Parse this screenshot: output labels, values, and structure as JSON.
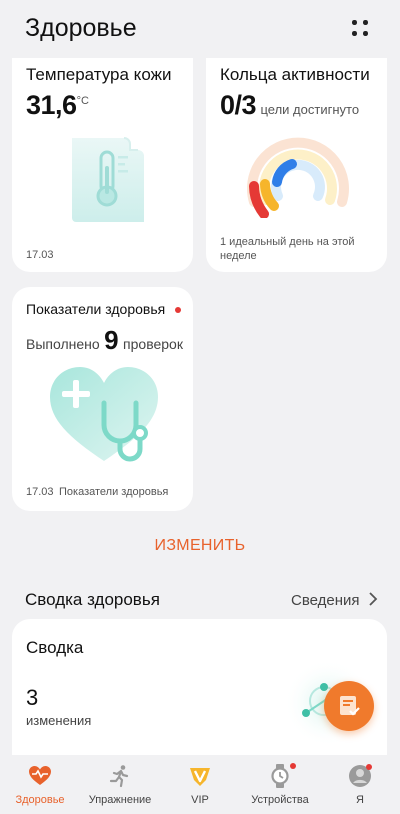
{
  "header": {
    "title": "Здоровье"
  },
  "skin_temp": {
    "title": "Температура кожи",
    "value": "31,6",
    "unit": "°C",
    "date": "17.03"
  },
  "activity": {
    "title": "Кольца активности",
    "value": "0/3",
    "suffix": "цели достигнуто",
    "note_line1": "1 идеальный день на этой",
    "note_line2": "неделе"
  },
  "health_indicators": {
    "title": "Показатели здоровья",
    "done_prefix": "Выполнено",
    "done_count": "9",
    "done_suffix": "проверок",
    "date": "17.03",
    "footer_label": "Показатели здоровья"
  },
  "edit_label": "ИЗМЕНИТЬ",
  "summary_section": {
    "title": "Сводка здоровья",
    "link": "Сведения"
  },
  "summary_card": {
    "title": "Сводка",
    "count": "3",
    "count_label": "изменения"
  },
  "tabs": [
    {
      "label": "Здоровье",
      "icon": "heart-pulse-icon",
      "active": true
    },
    {
      "label": "Упражнение",
      "icon": "running-icon",
      "active": false
    },
    {
      "label": "VIP",
      "icon": "vip-icon",
      "active": false
    },
    {
      "label": "Устройства",
      "icon": "watch-icon",
      "active": false
    },
    {
      "label": "Я",
      "icon": "user-icon",
      "active": false
    }
  ],
  "colors": {
    "accent": "#e8622c",
    "badge": "#e53935",
    "mint": "#7dd9c8"
  }
}
